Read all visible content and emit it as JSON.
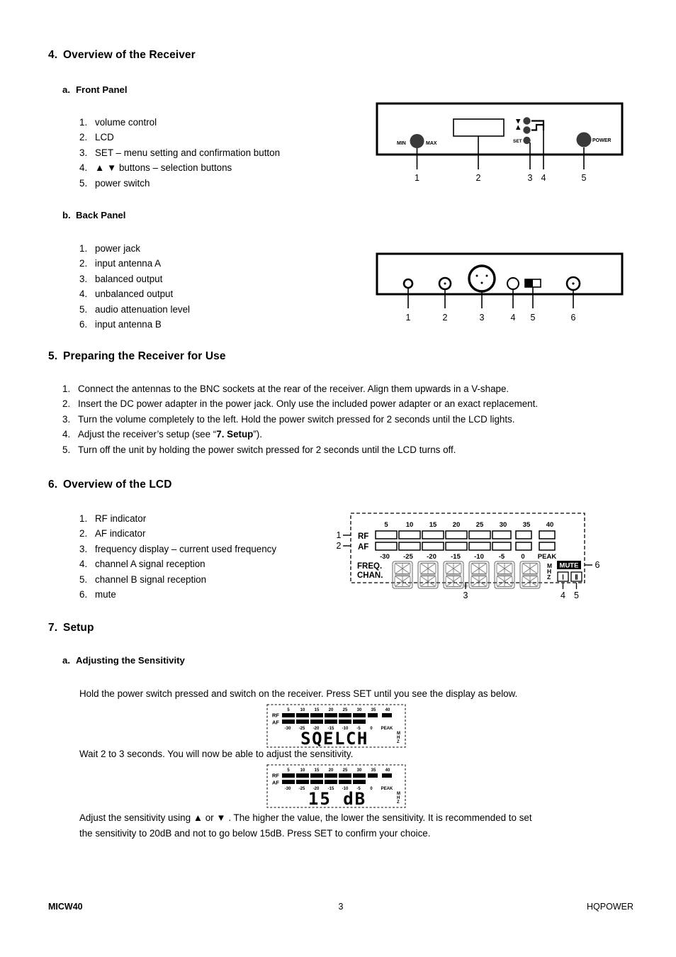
{
  "sections": {
    "s4": {
      "number": "4.",
      "title": "Overview of the Receiver"
    },
    "s4a": {
      "number": "a.",
      "title": "Front Panel"
    },
    "s4b": {
      "number": "b.",
      "title": "Back Panel"
    },
    "s5": {
      "number": "5.",
      "title": "Preparing the Receiver for Use"
    },
    "s6": {
      "number": "6.",
      "title": "Overview of the LCD"
    },
    "s7": {
      "number": "7.",
      "title": "Setup"
    },
    "s7a": {
      "number": "a.",
      "title": "Adjusting the Sensitivity"
    }
  },
  "front_panel_list": [
    {
      "idx": "1.",
      "text": "volume control"
    },
    {
      "idx": "2.",
      "text": "LCD"
    },
    {
      "idx": "3.",
      "text": "SET – menu setting and confirmation button"
    },
    {
      "idx": "4.",
      "text": "▲ ▼  buttons – selection buttons"
    },
    {
      "idx": "5.",
      "text": "power switch"
    }
  ],
  "back_panel_list": [
    {
      "idx": "1.",
      "text": "power jack"
    },
    {
      "idx": "2.",
      "text": "input antenna A"
    },
    {
      "idx": "3.",
      "text": "balanced output"
    },
    {
      "idx": "4.",
      "text": "unbalanced output"
    },
    {
      "idx": "5.",
      "text": "audio attenuation level"
    },
    {
      "idx": "6.",
      "text": "input antenna B"
    }
  ],
  "preparing_list": [
    {
      "idx": "1.",
      "text": "Connect the antennas to the BNC sockets at the rear of the receiver. Align them upwards in a V-shape."
    },
    {
      "idx": "2.",
      "text": "Insert the DC power adapter in the power jack. Only use the included power adapter or an exact replacement."
    },
    {
      "idx": "3.",
      "text": "Turn the volume completely to the left. Hold the power switch pressed for 2 seconds until the LCD lights."
    },
    {
      "idx": "4.",
      "text": "Adjust the receiver’s setup (see “7. Setup”)."
    },
    {
      "idx": "5.",
      "text": "Turn off the unit by holding the power switch pressed for 2 seconds until the LCD turns off."
    }
  ],
  "preparing_item4": {
    "prefix": "Adjust the receiver’s setup (see “",
    "bold": "7. Setup",
    "suffix": "”)."
  },
  "lcd_list": [
    {
      "idx": "1.",
      "text": "RF indicator"
    },
    {
      "idx": "2.",
      "text": "AF indicator"
    },
    {
      "idx": "3.",
      "text": "frequency display – current used frequency"
    },
    {
      "idx": "4.",
      "text": "channel A signal reception"
    },
    {
      "idx": "5.",
      "text": "channel B signal reception"
    },
    {
      "idx": "6.",
      "text": "mute"
    }
  ],
  "setup": {
    "intro": "Hold the power switch pressed and switch on the receiver. Press SET until you see the display as below.",
    "wait_line": "Wait 2 to 3 seconds. You will now be able to adjust the sensitivity.",
    "closing_line1": "Adjust the sensitivity using ▲  or ▼ . The higher the value, the lower the sensitivity. It is recommended to set",
    "closing_line2": "the sensitivity to 20dB and not to go below 15dB. Press SET to confirm your choice."
  },
  "front_panel_diagram": {
    "labels": {
      "min": "MIN",
      "max": "MAX",
      "set": "SET",
      "power": "POWER"
    },
    "callouts": [
      "1",
      "2",
      "3",
      "4",
      "5"
    ]
  },
  "back_panel_diagram": {
    "callouts": [
      "1",
      "2",
      "3",
      "4",
      "5",
      "6"
    ]
  },
  "lcd_diagram": {
    "rf_label": "RF",
    "af_label": "AF",
    "freq_label": "FREQ.",
    "chan_label": "CHAN.",
    "top_scale": [
      "5",
      "10",
      "15",
      "20",
      "25",
      "30",
      "35",
      "40"
    ],
    "bottom_scale": [
      "-30",
      "-25",
      "-20",
      "-15",
      "-10",
      "-5",
      "0",
      "PEAK"
    ],
    "mhz_letters": [
      "M",
      "H",
      "Z"
    ],
    "mute_label": "MUTE",
    "chan_a_label": "Ⅰ",
    "chan_b_label": "Ⅱ",
    "callouts_left": [
      "1",
      "2"
    ],
    "callouts_bottom": [
      "3",
      "4",
      "5"
    ],
    "callout_right": "6"
  },
  "squelch_display": {
    "rf_label": "RF",
    "af_label": "AF",
    "top_scale": [
      "5",
      "10",
      "15",
      "20",
      "25",
      "30",
      "35",
      "40"
    ],
    "bottom_scale": [
      "-30",
      "-25",
      "-20",
      "-15",
      "-10",
      "-5",
      "0",
      "PEAK"
    ],
    "rf_filled": 8,
    "af_filled": 6,
    "text": "SQELCH",
    "mhz_letters": [
      "M",
      "H",
      "Z"
    ]
  },
  "sensitivity_display": {
    "rf_label": "RF",
    "af_label": "AF",
    "top_scale": [
      "5",
      "10",
      "15",
      "20",
      "25",
      "30",
      "35",
      "40"
    ],
    "bottom_scale": [
      "-30",
      "-25",
      "-20",
      "-15",
      "-10",
      "-5",
      "0",
      "PEAK"
    ],
    "rf_filled": 8,
    "af_filled": 6,
    "text": "15 dB",
    "mhz_letters": [
      "M",
      "H",
      "Z"
    ]
  },
  "footer": {
    "left": "MICW40",
    "page": "3",
    "right": "HQPOWER"
  }
}
